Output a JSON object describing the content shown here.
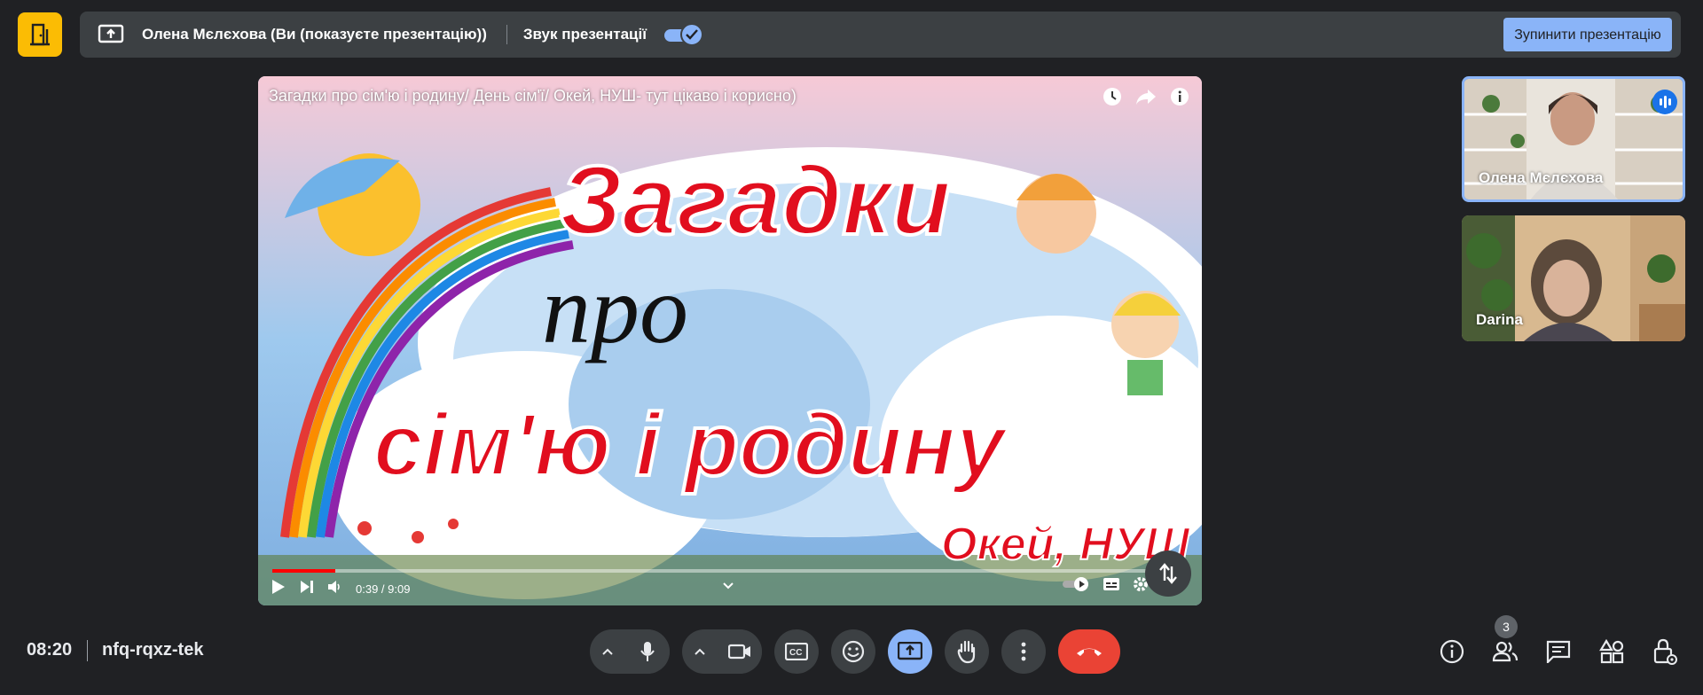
{
  "banner": {
    "presenter": "Олена Мєлєхова (Ви (показуєте презентацію))",
    "sound_label": "Звук презентації",
    "sound_on": true,
    "stop_label": "Зупинити презентацію"
  },
  "video": {
    "title": "Загадки про сім'ю і родину/ День сім'ї/ Окей, НУШ- тут цікаво і корисно)",
    "art_line1": "Загадки",
    "art_line2": "про",
    "art_line3": "сім'ю і родину",
    "art_line4": "Окей, НУШ",
    "time": "0:39 / 9:09",
    "progress_fraction": 0.071
  },
  "participants": [
    {
      "name": "Олена Мєлєхова",
      "speaking": true
    },
    {
      "name": "Darina",
      "speaking": false
    }
  ],
  "meeting": {
    "time": "08:20",
    "code": "nfq-rqxz-tek",
    "people_count": "3"
  },
  "colors": {
    "accent": "#8ab4f8",
    "end_call": "#ea4335",
    "door": "#fbbc04",
    "bg": "#202124"
  },
  "icons": [
    "door-icon",
    "present-screen-icon",
    "check-icon",
    "clock-icon",
    "share-icon",
    "info-icon",
    "play-icon",
    "next-icon",
    "volume-icon",
    "mic-icon",
    "camera-icon",
    "captions-icon",
    "emoji-icon",
    "raise-hand-icon",
    "more-icon",
    "end-call-icon",
    "people-icon",
    "chat-icon",
    "activities-icon",
    "host-controls-icon"
  ]
}
